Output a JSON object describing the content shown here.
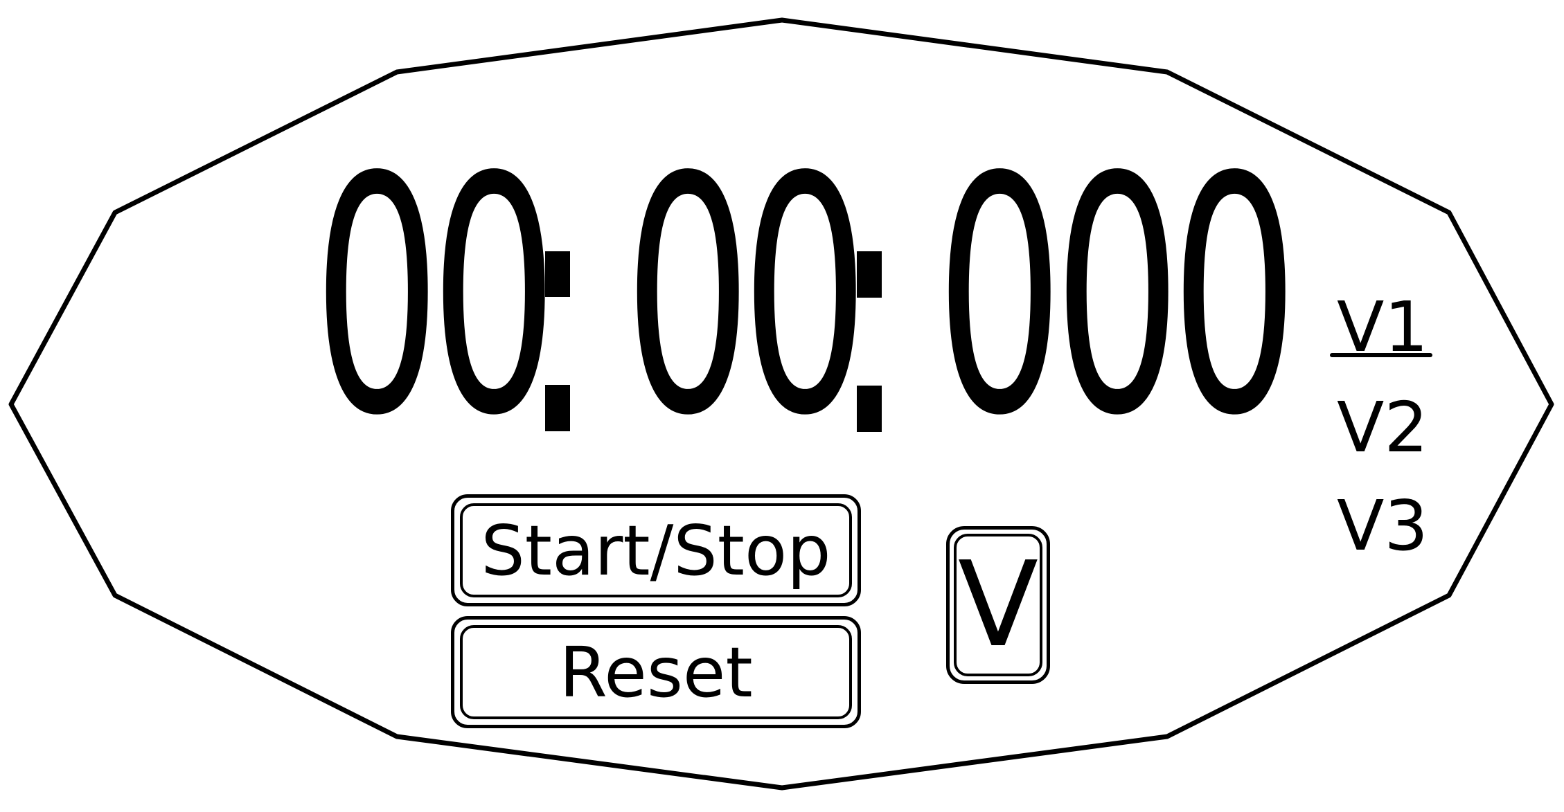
{
  "timer": {
    "display": "00:00:000",
    "minutes": [
      "0",
      "0"
    ],
    "seconds": [
      "0",
      "0"
    ],
    "milliseconds": [
      "0",
      "0",
      "0"
    ]
  },
  "controls": {
    "start_stop_label": "Start/Stop",
    "reset_label": "Reset",
    "version_toggle_label": "V"
  },
  "versions": {
    "items": [
      "V1",
      "V2",
      "V3"
    ],
    "selected": "V1"
  },
  "colors": {
    "foreground": "#000000",
    "background": "#ffffff"
  }
}
